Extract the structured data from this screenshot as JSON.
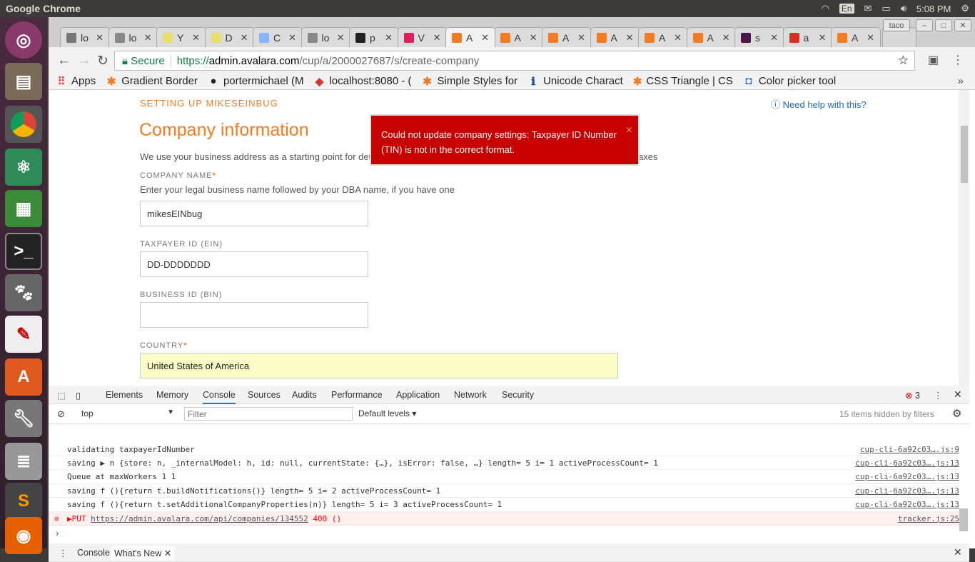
{
  "system": {
    "app_title": "Google Chrome",
    "lang": "En",
    "time": "5:08 PM"
  },
  "browser": {
    "tabs": [
      {
        "label": "lo",
        "icon": "file-icon",
        "color": "#777"
      },
      {
        "label": "lo",
        "icon": "shield-icon",
        "color": "#888"
      },
      {
        "label": "Y",
        "icon": "yb-icon",
        "color": "#e8e06a"
      },
      {
        "label": "D",
        "icon": "yb-icon",
        "color": "#e8e06a"
      },
      {
        "label": "C",
        "icon": "docs-icon",
        "color": "#8ab4f8"
      },
      {
        "label": "lo",
        "icon": "shield-icon",
        "color": "#888"
      },
      {
        "label": "p",
        "icon": "github-icon",
        "color": "#222"
      },
      {
        "label": "V",
        "icon": "slack-icon",
        "color": "#e01e5a"
      },
      {
        "label": "A",
        "icon": "avalara-icon",
        "color": "#f47b20"
      },
      {
        "label": "A",
        "icon": "avalara-icon",
        "color": "#f47b20"
      },
      {
        "label": "A",
        "icon": "avalara-icon",
        "color": "#f47b20"
      },
      {
        "label": "A",
        "icon": "avalara-icon",
        "color": "#f47b20"
      },
      {
        "label": "A",
        "icon": "avalara-icon",
        "color": "#f47b20"
      },
      {
        "label": "A",
        "icon": "avalara-icon",
        "color": "#f47b20"
      },
      {
        "label": "s",
        "icon": "hash-icon",
        "color": "#4a154b"
      },
      {
        "label": "a",
        "icon": "gmail-icon",
        "color": "#d93025"
      },
      {
        "label": "A",
        "icon": "avalara-icon",
        "color": "#f47b20"
      }
    ],
    "profile": "taco",
    "secure_label": "Secure",
    "url": {
      "scheme": "https://",
      "host": "admin.avalara.com",
      "path": "/cup/a/2000027687/s/create-company"
    },
    "bookmarks": [
      {
        "label": "Apps",
        "icon": "apps-icon"
      },
      {
        "label": "Gradient Border",
        "icon": "asterisk-icon"
      },
      {
        "label": "portermichael (M",
        "icon": "github-icon"
      },
      {
        "label": "localhost:8080 - (",
        "icon": "shield-icon"
      },
      {
        "label": "Simple Styles for",
        "icon": "asterisk-icon"
      },
      {
        "label": "Unicode Charact",
        "icon": "info-icon"
      },
      {
        "label": "CSS Triangle | CS",
        "icon": "asterisk-icon"
      },
      {
        "label": "Color picker tool",
        "icon": "color-picker-icon"
      }
    ],
    "more_bookmarks": "»"
  },
  "page": {
    "setup_heading": "SETTING UP MIKESEINBUG",
    "help_link": "Need help with this?",
    "title": "Company information",
    "intro_start": "We use your business address as a starting point for det",
    "intro_end": "axes",
    "company_name_label": "COMPANY NAME",
    "company_name_hint": "Enter your legal business name followed by your DBA name, if you have one",
    "company_name_value": "mikesEINbug",
    "taxpayer_label": "TAXPAYER ID (EIN)",
    "taxpayer_value": "DD-DDDDDDD",
    "business_id_label": "BUSINESS ID (BIN)",
    "business_id_value": "",
    "country_label": "COUNTRY",
    "country_value": "United States of America",
    "required_mark": "*",
    "toast": "Could not update company settings: Taxpayer ID Number (TIN) is not in the correct format.",
    "toast_close": "×"
  },
  "devtools": {
    "tabs": [
      "Elements",
      "Memory",
      "Console",
      "Sources",
      "Audits",
      "Performance",
      "Application",
      "Network",
      "Security"
    ],
    "active_tab": "Console",
    "error_count": "3",
    "context": "top",
    "filter_placeholder": "Filter",
    "levels": "Default levels",
    "hidden": "15 items hidden by filters",
    "logs": [
      {
        "text": "validating taxpayerIdNumber",
        "src": "cup-cli-6a92c03….js:9"
      },
      {
        "text": "saving ▶ n {store: n, _internalModel: h, id: null, currentState: {…}, isError: false, …} length= 5 i= 1 activeProcessCount= 1",
        "src": "cup-cli-6a92c03….js:13"
      },
      {
        "text": "Queue at maxWorkers 1 1",
        "src": "cup-cli-6a92c03….js:13"
      },
      {
        "text": "saving f (){return t.buildNotifications()} length= 5 i= 2 activeProcessCount= 1",
        "src": "cup-cli-6a92c03….js:13"
      },
      {
        "text": "saving f (){return t.setAdditionalCompanyProperties(n)} length= 5 i= 3 activeProcessCount= 1",
        "src": "cup-cli-6a92c03….js:13"
      }
    ],
    "error": {
      "method": "▶PUT",
      "url": "https://admin.avalara.com/api/companies/134552",
      "status": "400 ()",
      "src": "tracker.js:25"
    },
    "prompt": "›",
    "drawer_tabs": [
      "Console",
      "What's New"
    ]
  }
}
